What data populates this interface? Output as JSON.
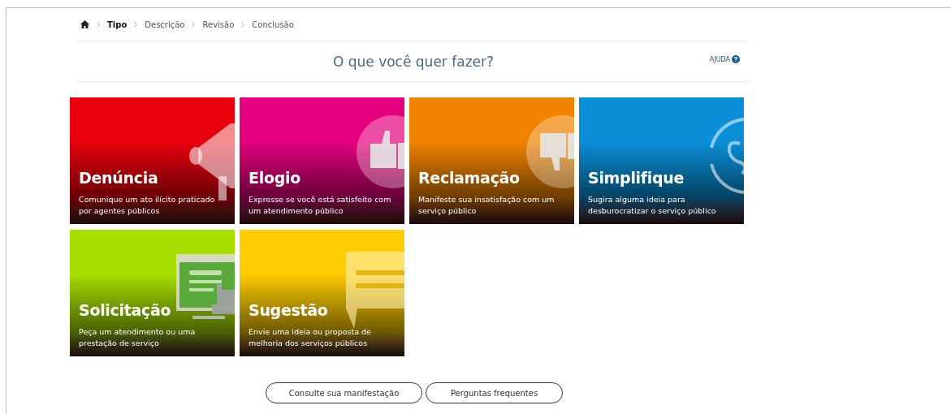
{
  "breadcrumb": [
    {
      "label": "Tipo",
      "selected": true
    },
    {
      "label": "Descrição",
      "selected": false
    },
    {
      "label": "Revisão",
      "selected": false
    },
    {
      "label": "Conclusão",
      "selected": false
    }
  ],
  "heading": "O que você quer fazer?",
  "help": {
    "label": "AJUDA"
  },
  "tiles": [
    {
      "title": "Denúncia",
      "description": "Comunique um ato ilícito praticado por agentes públicos",
      "color": "#e8000d",
      "kind": "megaphone"
    },
    {
      "title": "Elogio",
      "description": "Expresse se você está satisfeito com um atendimento público",
      "color": "#e5007e",
      "kind": "thumbs-up"
    },
    {
      "title": "Reclamação",
      "description": "Manifeste sua insatisfação com um serviço público",
      "color": "#f08300",
      "kind": "thumbs-down"
    },
    {
      "title": "Simplifique",
      "description": "Sugira alguma ideia para desburocratizar o serviço público",
      "color": "#0a8fd8",
      "kind": "s-logo"
    },
    {
      "title": "Solicitação",
      "description": "Peça um atendimento ou uma prestação de serviço",
      "color": "#a6df00",
      "kind": "monitor"
    },
    {
      "title": "Sugestão",
      "description": "Envie uma ideia ou proposta de melhoria dos serviços públicos",
      "color": "#ffcc00",
      "kind": "speech"
    }
  ],
  "buttons": [
    "Consulte sua manifestação",
    "Perguntas frequentes"
  ]
}
